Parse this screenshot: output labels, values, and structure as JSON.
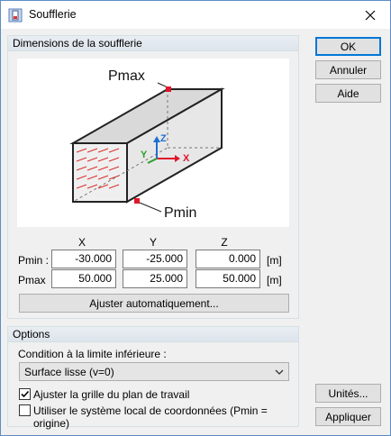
{
  "window": {
    "title": "Soufflerie"
  },
  "dimensions": {
    "group_title": "Dimensions de la soufflerie",
    "diagram": {
      "pmax_label": "Pmax",
      "pmin_label": "Pmin",
      "axis_x": "X",
      "axis_y": "Y",
      "axis_z": "Z"
    },
    "col_x": "X",
    "col_y": "Y",
    "col_z": "Z",
    "pmin": {
      "label": "Pmin :",
      "x": "-30.000",
      "y": "-25.000",
      "z": "0.000",
      "unit": "[m]"
    },
    "pmax": {
      "label": "Pmax",
      "x": "50.000",
      "y": "25.000",
      "z": "50.000",
      "unit": "[m]"
    },
    "auto_button": "Ajuster automatiquement..."
  },
  "options": {
    "group_title": "Options",
    "condition_label": "Condition à la limite inférieure :",
    "condition_value": "Surface lisse (v=0)",
    "check_grid": {
      "label": "Ajuster la grille du plan de travail",
      "checked": true
    },
    "check_local": {
      "label": "Utiliser le système local de coordonnées (Pmin = origine)",
      "checked": false
    }
  },
  "buttons": {
    "ok": "OK",
    "cancel": "Annuler",
    "help": "Aide",
    "units": "Unités...",
    "apply": "Appliquer"
  },
  "colors": {
    "accent": "#0078d7",
    "marker": "#e0162b",
    "arrow": "#d9302c"
  }
}
